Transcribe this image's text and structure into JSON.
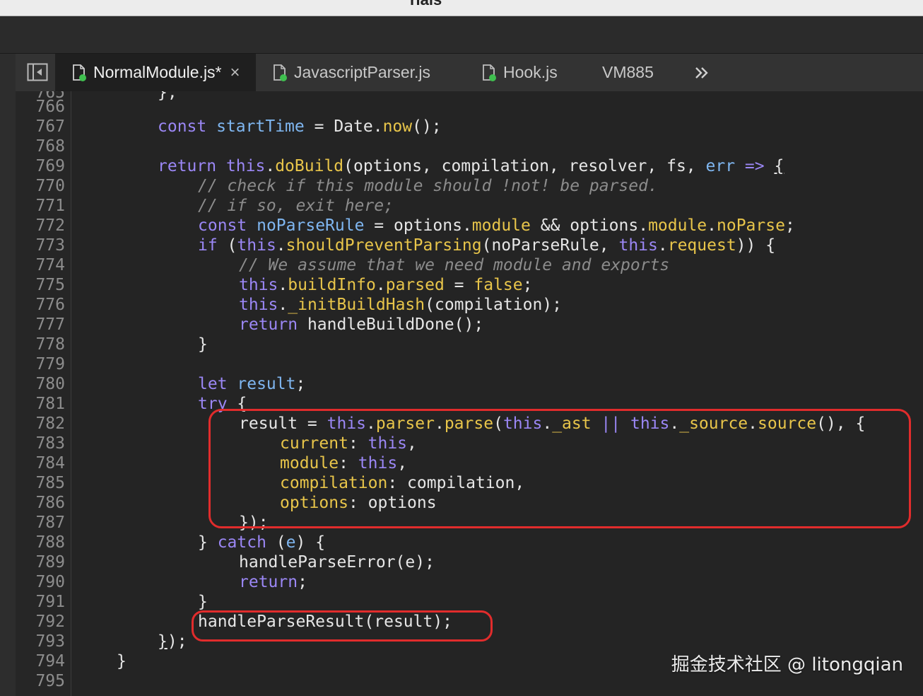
{
  "window": {
    "title": "rials"
  },
  "tabs": [
    {
      "label": "NormalModule.js*",
      "active": true,
      "close": "×"
    },
    {
      "label": "JavascriptParser.js",
      "active": false
    },
    {
      "label": "Hook.js",
      "active": false
    },
    {
      "label": "VM885",
      "active": false
    }
  ],
  "overflow_label": "»",
  "partial_top": "};",
  "line_numbers": [
    "766",
    "767",
    "768",
    "769",
    "770",
    "771",
    "772",
    "773",
    "774",
    "775",
    "776",
    "777",
    "778",
    "779",
    "780",
    "781",
    "782",
    "783",
    "784",
    "785",
    "786",
    "787",
    "788",
    "789",
    "790",
    "791",
    "792",
    "793",
    "794",
    "795"
  ],
  "code": {
    "l767": [
      "const",
      "startTime",
      "=",
      "Date.",
      "now",
      "();"
    ],
    "l769": [
      "return",
      "this",
      ".",
      "doBuild",
      "(options, compilation, resolver, fs, ",
      "err",
      " => ",
      "{"
    ],
    "l770": "// check if this module should !not! be parsed.",
    "l771": "// if so, exit here;",
    "l772": [
      "const",
      "noParseRule",
      "=",
      "options.",
      "module",
      " && options.",
      "module",
      ".",
      "noParse",
      ";"
    ],
    "l773": [
      "if",
      " (",
      "this",
      ".",
      "shouldPreventParsing",
      "(noParseRule, ",
      "this",
      ".",
      "request",
      ")) {"
    ],
    "l774": "// We assume that we need module and exports",
    "l775": [
      "this",
      ".",
      "buildInfo",
      ".",
      "parsed",
      " = ",
      "false",
      ";"
    ],
    "l776": [
      "this",
      ".",
      "_initBuildHash",
      "(compilation);"
    ],
    "l777": [
      "return",
      " handleBuildDone();"
    ],
    "l778": "}",
    "l780": [
      "let",
      " result",
      ";"
    ],
    "l781": [
      "try",
      " {"
    ],
    "l782": [
      "result = ",
      "this",
      ".",
      "parser",
      ".",
      "parse",
      "(",
      "this",
      ".",
      "_ast",
      " || ",
      "this",
      ".",
      "_source",
      ".",
      "source",
      "(), {"
    ],
    "l783": [
      "current",
      ": ",
      "this",
      ","
    ],
    "l784": [
      "module",
      ": ",
      "this",
      ","
    ],
    "l785": [
      "compilation",
      ": compilation,"
    ],
    "l786": [
      "options",
      ": options"
    ],
    "l787": "});",
    "l788": [
      "} ",
      "catch",
      " (",
      "e",
      ") {"
    ],
    "l789": "handleParseError(e);",
    "l790": [
      "return",
      ";"
    ],
    "l791": "}",
    "l792": "handleParseResult(result);",
    "l793": [
      "}",
      ");"
    ],
    "l794": "}"
  },
  "watermark": "掘金技术社区 @ litongqian",
  "colors": {
    "keyword": "#9b87f5",
    "identifier": "#7fb6f0",
    "property": "#e8c54a",
    "comment": "#8c8c8c",
    "highlight": "#e12c2c"
  },
  "icons": [
    "sidebar-toggle-icon",
    "file-icon",
    "close-icon",
    "overflow-chevron-icon"
  ]
}
